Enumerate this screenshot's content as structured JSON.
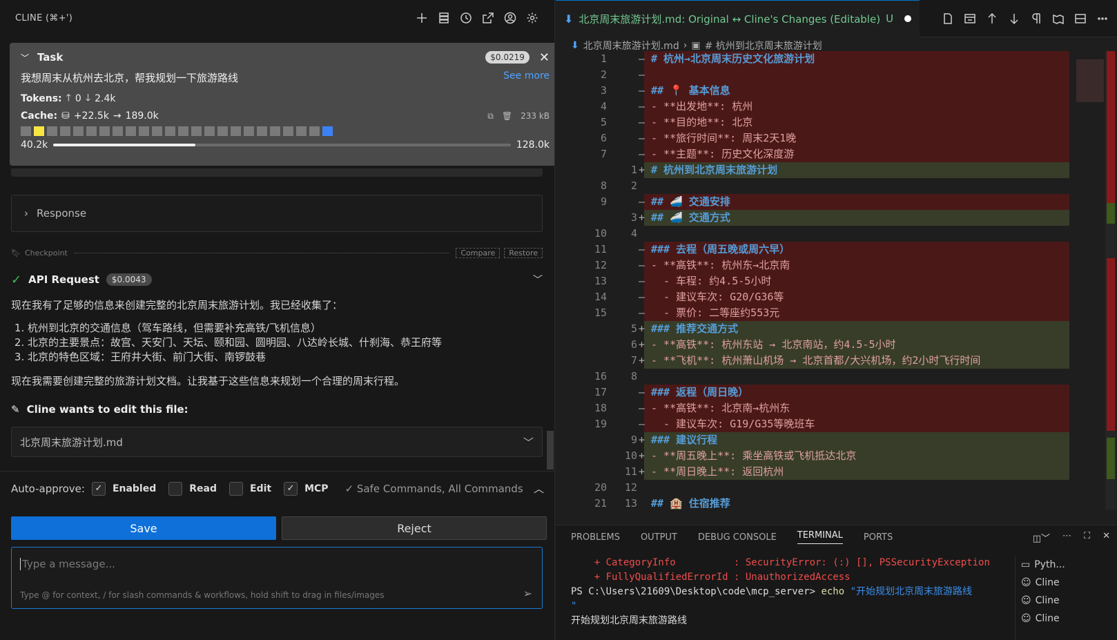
{
  "cline": {
    "title": "CLINE (⌘+')",
    "task": {
      "label": "Task",
      "cost": "$0.0219",
      "prompt": "我想周末从杭州去北京，帮我规划一下旅游路线",
      "see_more": "See more",
      "tokens_label": "Tokens:",
      "tokens_up": "0",
      "tokens_down": "2.4k",
      "cache_label": "Cache:",
      "cache_write": "+22.5k",
      "cache_read": "189.0k",
      "size": "233 kB",
      "context_used": "40.2k",
      "context_max": "128.0k",
      "context_fraction": 0.31
    },
    "response_label": "Response",
    "checkpoint": {
      "label": "Checkpoint",
      "compare": "Compare",
      "restore": "Restore"
    },
    "api_request": {
      "label": "API Request",
      "cost": "$0.0043"
    },
    "message": {
      "intro": "现在我有了足够的信息来创建完整的北京周末旅游计划。我已经收集了：",
      "items": [
        "杭州到北京的交通信息（驾车路线，但需要补充高铁/飞机信息）",
        "北京的主要景点：故宫、天安门、天坛、颐和园、圆明园、八达岭长城、什刹海、恭王府等",
        "北京的特色区域：王府井大街、前门大街、南锣鼓巷"
      ],
      "outro": "现在我需要创建完整的旅游计划文档。让我基于这些信息来规划一个合理的周末行程。"
    },
    "edit_header": "Cline wants to edit this file:",
    "edit_file": "北京周末旅游计划.md",
    "auto_approve": {
      "label": "Auto-approve:",
      "enabled": "Enabled",
      "read": "Read",
      "edit": "Edit",
      "mcp": "MCP",
      "extra": "Safe Commands, All Commands"
    },
    "save": "Save",
    "reject": "Reject",
    "input_placeholder": "Type a message...",
    "input_hint": "Type @ for context, / for slash commands & workflows, hold shift to drag in files/images"
  },
  "editor": {
    "tab_title": "北京周末旅游计划.md: Original ↔ Cline's Changes (Editable)",
    "tab_status": "U",
    "breadcrumb_file": "北京周末旅游计划.md",
    "breadcrumb_section": "# 杭州到北京周末旅游计划",
    "lines": [
      {
        "o": "1",
        "n": "",
        "m": "—",
        "t": "# 杭州→北京周末历史文化旅游计划",
        "k": "del",
        "s": "h"
      },
      {
        "o": "2",
        "n": "",
        "m": "—",
        "t": "",
        "k": "del",
        "s": ""
      },
      {
        "o": "3",
        "n": "",
        "m": "—",
        "t": "## 📍 基本信息",
        "k": "del",
        "s": "h"
      },
      {
        "o": "4",
        "n": "",
        "m": "—",
        "t": "- **出发地**: 杭州",
        "k": "del",
        "s": "b"
      },
      {
        "o": "5",
        "n": "",
        "m": "—",
        "t": "- **目的地**: 北京",
        "k": "del",
        "s": "b"
      },
      {
        "o": "6",
        "n": "",
        "m": "—",
        "t": "- **旅行时间**: 周末2天1晚",
        "k": "del",
        "s": "b"
      },
      {
        "o": "7",
        "n": "",
        "m": "—",
        "t": "- **主题**: 历史文化深度游",
        "k": "del",
        "s": "b"
      },
      {
        "o": "",
        "n": "1",
        "m": "+",
        "t": "# 杭州到北京周末旅游计划",
        "k": "add",
        "s": "h"
      },
      {
        "o": "8",
        "n": "2",
        "m": "",
        "t": "",
        "k": "",
        "s": ""
      },
      {
        "o": "9",
        "n": "",
        "m": "—",
        "t": "## 🚄 交通安排",
        "k": "del",
        "s": "h"
      },
      {
        "o": "",
        "n": "3",
        "m": "+",
        "t": "## 🚄 交通方式",
        "k": "add",
        "s": "h"
      },
      {
        "o": "10",
        "n": "4",
        "m": "",
        "t": "",
        "k": "",
        "s": ""
      },
      {
        "o": "11",
        "n": "",
        "m": "—",
        "t": "### 去程（周五晚或周六早）",
        "k": "del",
        "s": "h"
      },
      {
        "o": "12",
        "n": "",
        "m": "—",
        "t": "- **高铁**: 杭州东→北京南",
        "k": "del",
        "s": "b"
      },
      {
        "o": "13",
        "n": "",
        "m": "—",
        "t": "  - 车程: 约4.5-5小时",
        "k": "del",
        "s": "b"
      },
      {
        "o": "14",
        "n": "",
        "m": "—",
        "t": "  - 建议车次: G20/G36等",
        "k": "del",
        "s": "b"
      },
      {
        "o": "15",
        "n": "",
        "m": "—",
        "t": "  - 票价: 二等座约553元",
        "k": "del",
        "s": "b"
      },
      {
        "o": "",
        "n": "5",
        "m": "+",
        "t": "### 推荐交通方式",
        "k": "add",
        "s": "h"
      },
      {
        "o": "",
        "n": "6",
        "m": "+",
        "t": "- **高铁**: 杭州东站 → 北京南站，约4.5-5小时",
        "k": "add",
        "s": "b"
      },
      {
        "o": "",
        "n": "7",
        "m": "+",
        "t": "- **飞机**: 杭州萧山机场 → 北京首都/大兴机场，约2小时飞行时间",
        "k": "add",
        "s": "b"
      },
      {
        "o": "16",
        "n": "8",
        "m": "",
        "t": "",
        "k": "",
        "s": ""
      },
      {
        "o": "17",
        "n": "",
        "m": "—",
        "t": "### 返程（周日晚）",
        "k": "del",
        "s": "h"
      },
      {
        "o": "18",
        "n": "",
        "m": "—",
        "t": "- **高铁**: 北京南→杭州东",
        "k": "del",
        "s": "b"
      },
      {
        "o": "19",
        "n": "",
        "m": "—",
        "t": "  - 建议车次: G19/G35等晚班车",
        "k": "del",
        "s": "b"
      },
      {
        "o": "",
        "n": "9",
        "m": "+",
        "t": "### 建议行程",
        "k": "add",
        "s": "h"
      },
      {
        "o": "",
        "n": "10",
        "m": "+",
        "t": "- **周五晚上**: 乘坐高铁或飞机抵达北京",
        "k": "add",
        "s": "b"
      },
      {
        "o": "",
        "n": "11",
        "m": "+",
        "t": "- **周日晚上**: 返回杭州",
        "k": "add",
        "s": "b"
      },
      {
        "o": "20",
        "n": "12",
        "m": "",
        "t": "",
        "k": "",
        "s": ""
      },
      {
        "o": "21",
        "n": "13",
        "m": "",
        "t": "## 🏨 住宿推荐",
        "k": "",
        "s": "h"
      }
    ]
  },
  "panel": {
    "tabs": [
      "PROBLEMS",
      "OUTPUT",
      "DEBUG CONSOLE",
      "TERMINAL",
      "PORTS"
    ],
    "active_tab": "TERMINAL",
    "terminal": {
      "err1": "    + CategoryInfo          : SecurityError: (:) [], PSSecurityException",
      "err2": "    + FullyQualifiedErrorId : UnauthorizedAccess",
      "prompt": "PS C:\\Users\\21609\\Desktop\\code\\mcp_server>",
      "cmd": "echo",
      "arg": "\"开始规划北京周末旅游路线",
      "arg_cont": "\"",
      "output": "开始规划北京周末旅游路线"
    },
    "terminals": [
      "Pyth...",
      "Cline",
      "Cline",
      "Cline"
    ]
  },
  "colors": {
    "accent": "#0e70d8",
    "add_bg": "#373d29",
    "del_bg": "#4b1818",
    "file_new": "#73c991"
  }
}
